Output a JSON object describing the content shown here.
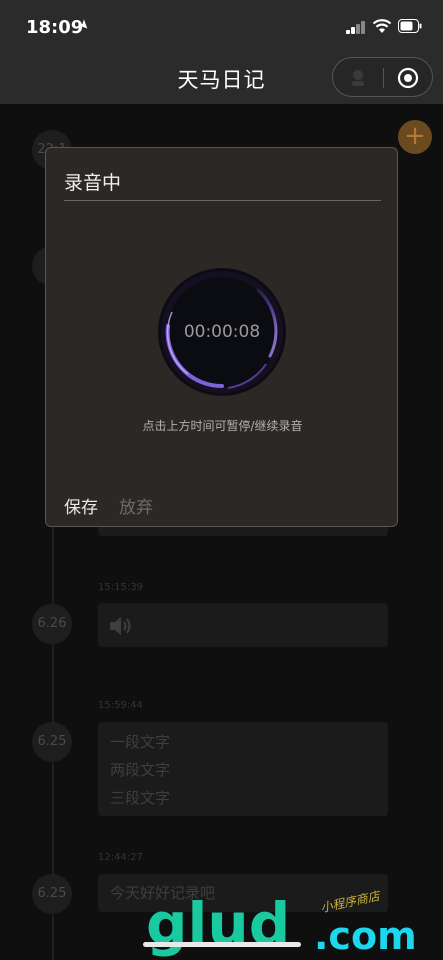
{
  "status_bar": {
    "time": "18:09",
    "icons": [
      "location-arrow-icon",
      "signal-icon",
      "wifi-icon",
      "battery-icon"
    ]
  },
  "nav": {
    "title": "天马日记",
    "capsule_icons": [
      "more-dots-icon",
      "target-circle-icon"
    ]
  },
  "timeline": {
    "entries": [
      {
        "date": "22:1",
        "time": "",
        "text": ""
      },
      {
        "date": "6.",
        "time": "",
        "text": ""
      },
      {
        "date": "6.26",
        "time": "15:15:39",
        "type": "audio"
      },
      {
        "date": "6.25",
        "time": "15:59:44",
        "lines": [
          "一段文字",
          "两段文字",
          "三段文字"
        ]
      },
      {
        "date": "6.25",
        "time": "12:44:27",
        "lines": [
          "今天好好记录吧"
        ]
      }
    ],
    "add_button": "+"
  },
  "modal": {
    "title": "录音中",
    "timer": "00:00:08",
    "hint": "点击上方时间可暂停/继续录音",
    "save_label": "保存",
    "discard_label": "放弃"
  },
  "watermark": {
    "main": "glud",
    "domain": ".com",
    "sub": "小程序商店"
  },
  "colors": {
    "accent_orange": "#6b4a1f",
    "ring_purple": "#8b6cf0",
    "watermark_green": "#19c9a0",
    "watermark_cyan": "#1dd7ee"
  }
}
